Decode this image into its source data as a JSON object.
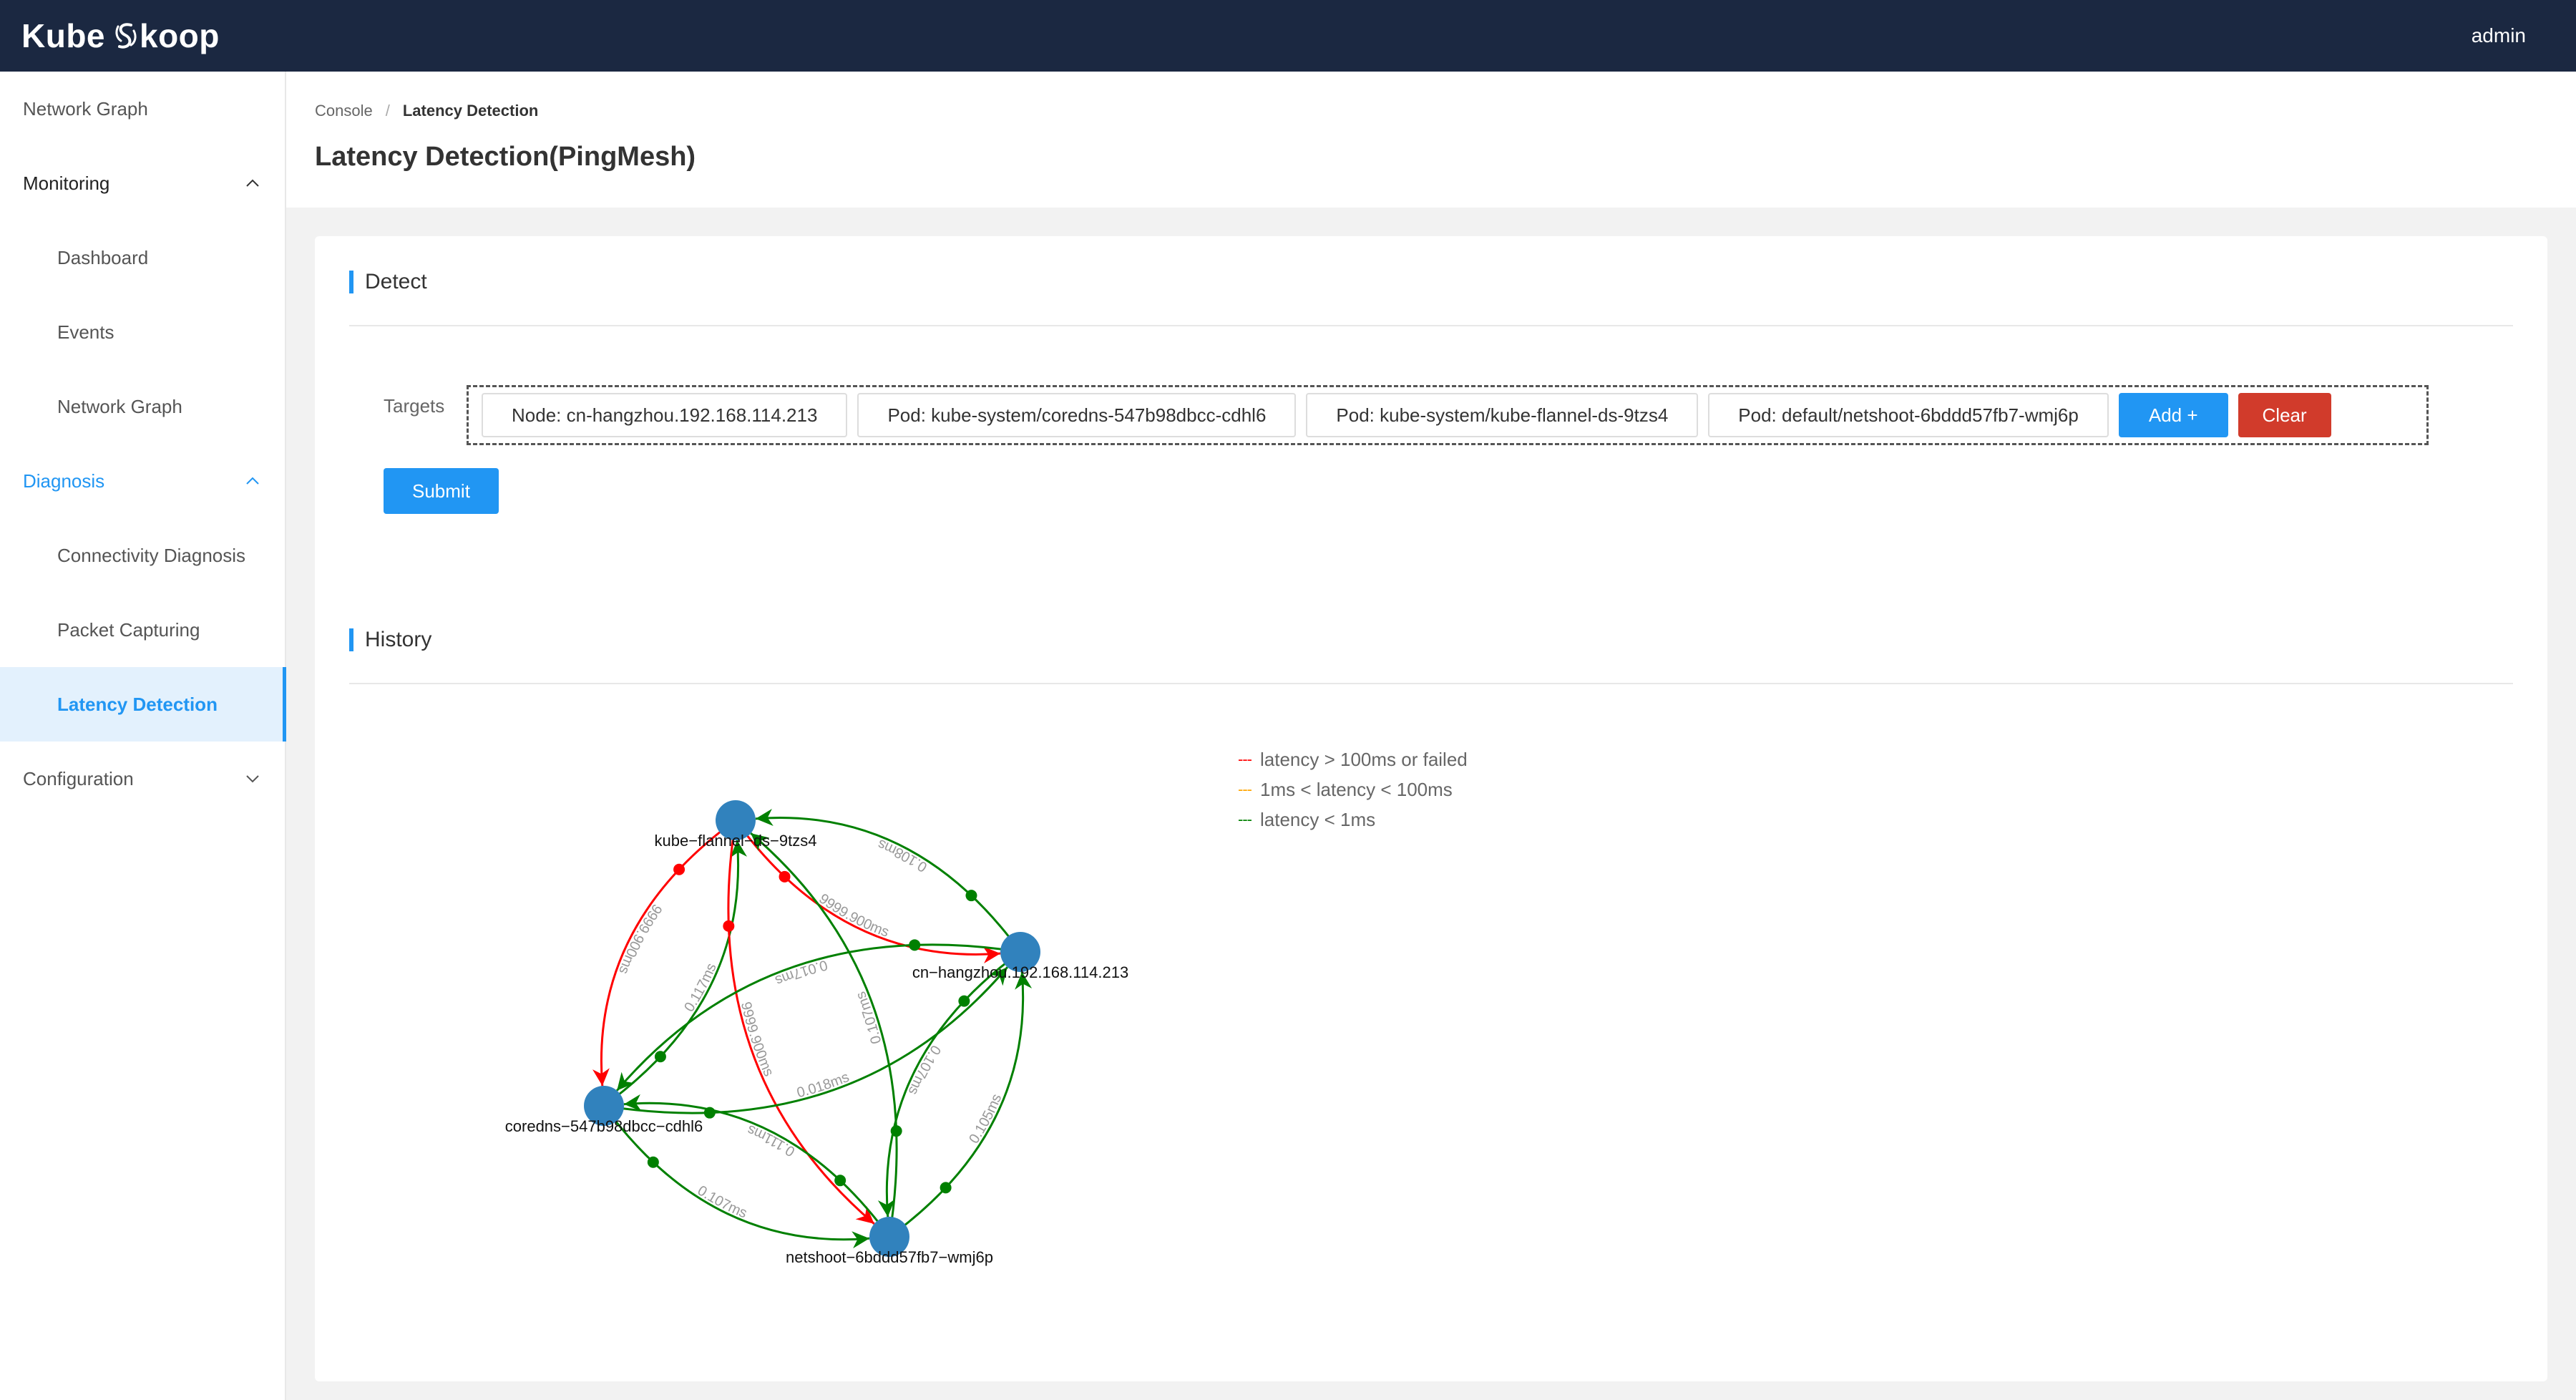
{
  "app": {
    "brand_left": "Kube",
    "brand_right": "koop",
    "user": "admin"
  },
  "sidebar": {
    "items": [
      {
        "label": "Network Graph",
        "type": "item"
      },
      {
        "label": "Monitoring",
        "type": "group",
        "expanded": true
      },
      {
        "label": "Dashboard",
        "type": "sub"
      },
      {
        "label": "Events",
        "type": "sub"
      },
      {
        "label": "Network Graph",
        "type": "sub"
      },
      {
        "label": "Diagnosis",
        "type": "group",
        "expanded": true,
        "active": true
      },
      {
        "label": "Connectivity Diagnosis",
        "type": "sub"
      },
      {
        "label": "Packet Capturing",
        "type": "sub"
      },
      {
        "label": "Latency Detection",
        "type": "sub",
        "active": true
      },
      {
        "label": "Configuration",
        "type": "group",
        "expanded": false
      }
    ]
  },
  "breadcrumb": {
    "root": "Console",
    "separator": "/",
    "current": "Latency Detection"
  },
  "page": {
    "title": "Latency Detection(PingMesh)"
  },
  "detect": {
    "title": "Detect",
    "targets_label": "Targets",
    "targets": [
      "Node: cn-hangzhou.192.168.114.213",
      "Pod: kube-system/coredns-547b98dbcc-cdhl6",
      "Pod: kube-system/kube-flannel-ds-9tzs4",
      "Pod: default/netshoot-6bddd57fb7-wmj6p"
    ],
    "add_label": "Add +",
    "clear_label": "Clear",
    "submit_label": "Submit"
  },
  "history": {
    "title": "History",
    "legend": [
      {
        "label": "latency > 100ms or failed",
        "color": "#ff0000"
      },
      {
        "label": "1ms < latency < 100ms",
        "color": "#ffa500"
      },
      {
        "label": "latency < 1ms",
        "color": "#008000"
      }
    ],
    "nodes": [
      {
        "id": "flannel",
        "label": "kube−flannel−ds−9tzs4"
      },
      {
        "id": "node",
        "label": "cn−hangzhou.192.168.114.213"
      },
      {
        "id": "coredns",
        "label": "coredns−547b98dbcc−cdhl6"
      },
      {
        "id": "netshoot",
        "label": "netshoot−6bddd57fb7−wmj6p"
      }
    ],
    "edges": [
      {
        "from": "flannel",
        "to": "node",
        "latency": "9999.900ms",
        "status": "failed"
      },
      {
        "from": "node",
        "to": "flannel",
        "latency": "0.108ms",
        "status": "ok"
      },
      {
        "from": "flannel",
        "to": "coredns",
        "latency": "9999.900ms",
        "status": "failed"
      },
      {
        "from": "coredns",
        "to": "flannel",
        "latency": "0.117ms",
        "status": "ok"
      },
      {
        "from": "flannel",
        "to": "netshoot",
        "latency": "9999.900ms",
        "status": "failed"
      },
      {
        "from": "netshoot",
        "to": "flannel",
        "latency": "0.107ms",
        "status": "ok"
      },
      {
        "from": "node",
        "to": "coredns",
        "latency": "0.017ms",
        "status": "ok"
      },
      {
        "from": "coredns",
        "to": "node",
        "latency": "0.018ms",
        "status": "ok"
      },
      {
        "from": "node",
        "to": "netshoot",
        "latency": "0.107ms",
        "status": "ok"
      },
      {
        "from": "netshoot",
        "to": "node",
        "latency": "0.105ms",
        "status": "ok"
      },
      {
        "from": "coredns",
        "to": "netshoot",
        "latency": "0.107ms",
        "status": "ok"
      },
      {
        "from": "netshoot",
        "to": "coredns",
        "latency": "0.111ms",
        "status": "ok"
      }
    ],
    "colors": {
      "failed": "#ff0000",
      "slow": "#ffa500",
      "ok": "#008000",
      "node": "#3182bd"
    }
  }
}
